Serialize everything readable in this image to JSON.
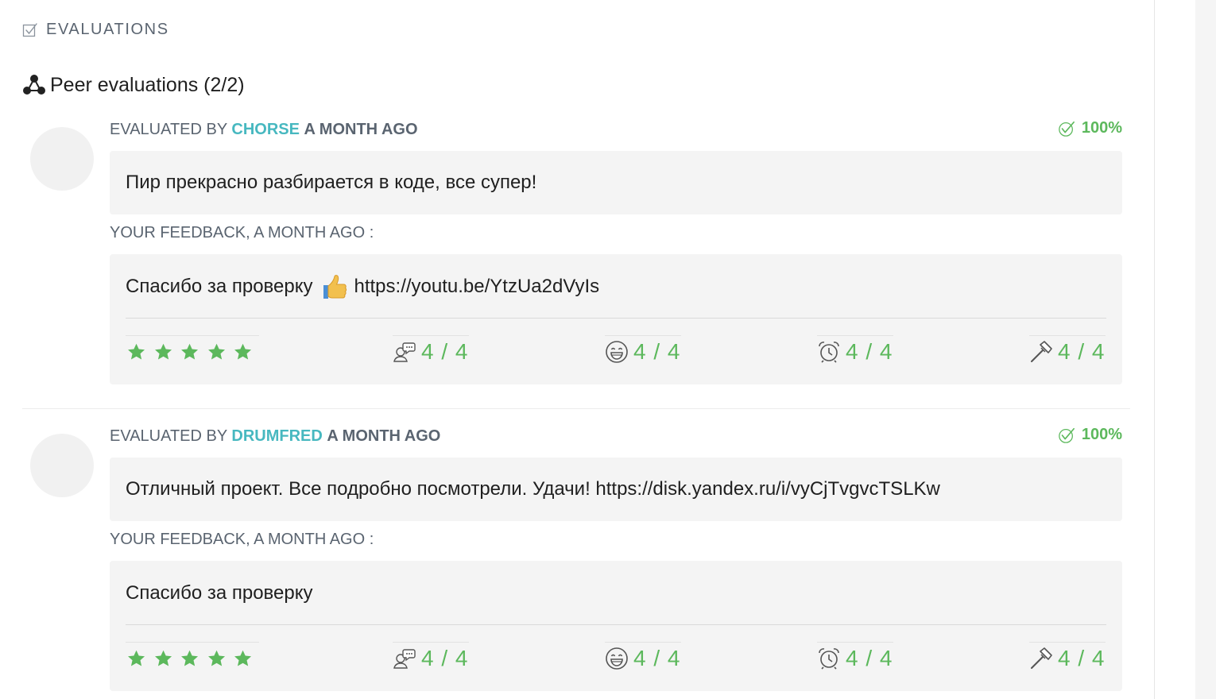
{
  "section": {
    "title": "EVALUATIONS",
    "icon": "checkbox-icon"
  },
  "peer": {
    "title": "Peer evaluations (2/2)",
    "icon": "network-icon"
  },
  "colors": {
    "accent_teal": "#47b8c0",
    "success_green": "#5cb85c",
    "muted_text": "#5a6470"
  },
  "evaluations": [
    {
      "evaluated_by": "EVALUATED BY",
      "evaluator": "CHORSE",
      "when": "A MONTH AGO",
      "percent": "100%",
      "comment": "Пир прекрасно разбирается в коде, все супер!",
      "feedback_label": "YOUR FEEDBACK, A MONTH AGO :",
      "feedback_text_before": "Спасибо за проверку",
      "feedback_emoji": "thumbs-up-icon",
      "feedback_text_after": "https://youtu.be/YtzUa2dVyIs",
      "stars": 5,
      "ratings": [
        {
          "icon": "speech-icon",
          "score": "4 / 4"
        },
        {
          "icon": "smiley-icon",
          "score": "4 / 4"
        },
        {
          "icon": "alarm-clock-icon",
          "score": "4 / 4"
        },
        {
          "icon": "hammer-icon",
          "score": "4 / 4"
        }
      ]
    },
    {
      "evaluated_by": "EVALUATED BY",
      "evaluator": "DRUMFRED",
      "when": "A MONTH AGO",
      "percent": "100%",
      "comment": "Отличный проект. Все подробно посмотрели. Удачи! https://disk.yandex.ru/i/vyCjTvgvcTSLKw",
      "feedback_label": "YOUR FEEDBACK, A MONTH AGO :",
      "feedback_text_before": "Спасибо за проверку",
      "feedback_emoji": "",
      "feedback_text_after": "",
      "stars": 5,
      "ratings": [
        {
          "icon": "speech-icon",
          "score": "4 / 4"
        },
        {
          "icon": "smiley-icon",
          "score": "4 / 4"
        },
        {
          "icon": "alarm-clock-icon",
          "score": "4 / 4"
        },
        {
          "icon": "hammer-icon",
          "score": "4 / 4"
        }
      ]
    }
  ]
}
